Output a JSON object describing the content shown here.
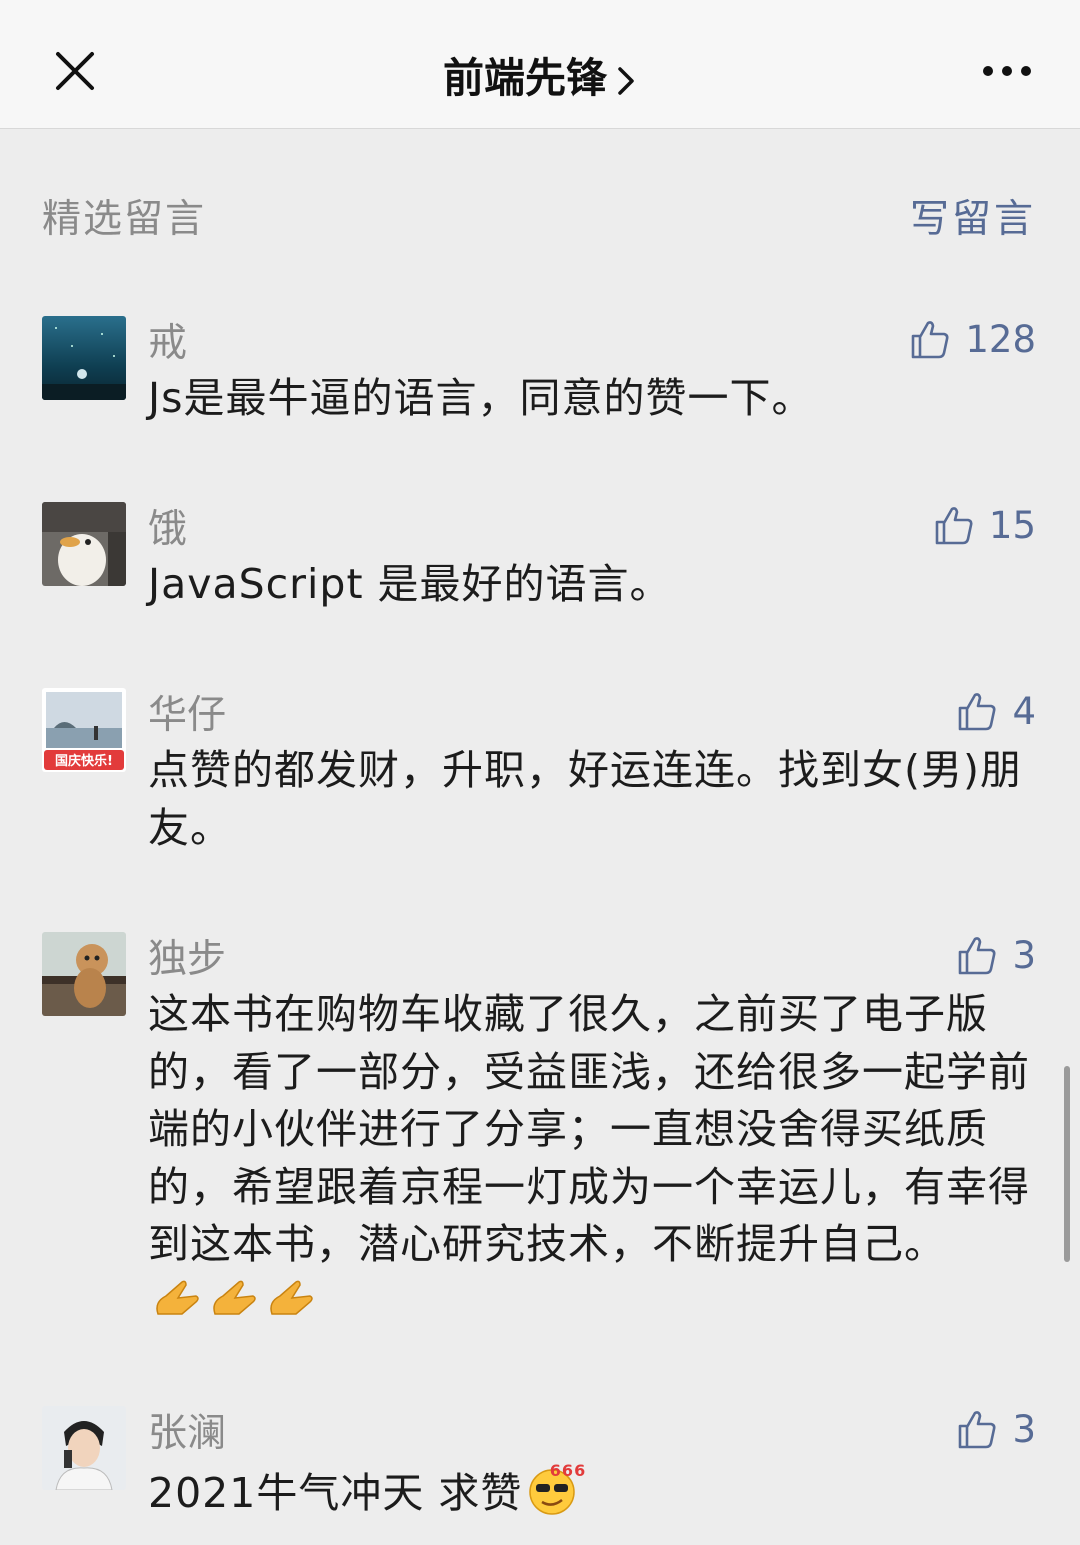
{
  "header": {
    "title": "前端先锋"
  },
  "section": {
    "title": "精选留言",
    "write_label": "写留言"
  },
  "comments": [
    {
      "nickname": "戒",
      "likes": "128",
      "text": "Js是最牛逼的语言，同意的赞一下。"
    },
    {
      "nickname": "饿",
      "likes": "15",
      "text": "JavaScript 是最好的语言。"
    },
    {
      "nickname": "华仔",
      "likes": "4",
      "avatar_badge": "国庆快乐!",
      "text": "点赞的都发财，升职，好运连连。找到女(男)朋友。"
    },
    {
      "nickname": "独步",
      "likes": "3",
      "text": "这本书在购物车收藏了很久，之前买了电子版的，看了一部分，受益匪浅，还给很多一起学前端的小伙伴进行了分享；一直想没舍得买纸质的，希望跟着京程一灯成为一个幸运儿，有幸得到这本书，潜心研究技术，不断提升自己。"
    },
    {
      "nickname": "张澜",
      "likes": "3",
      "text": "2021牛气冲天 求赞",
      "emoji_text": "666"
    }
  ],
  "colors": {
    "link": "#576b95",
    "secondary_text": "#8a8a8a",
    "background": "#ededed",
    "header_bg": "#f7f7f7"
  }
}
